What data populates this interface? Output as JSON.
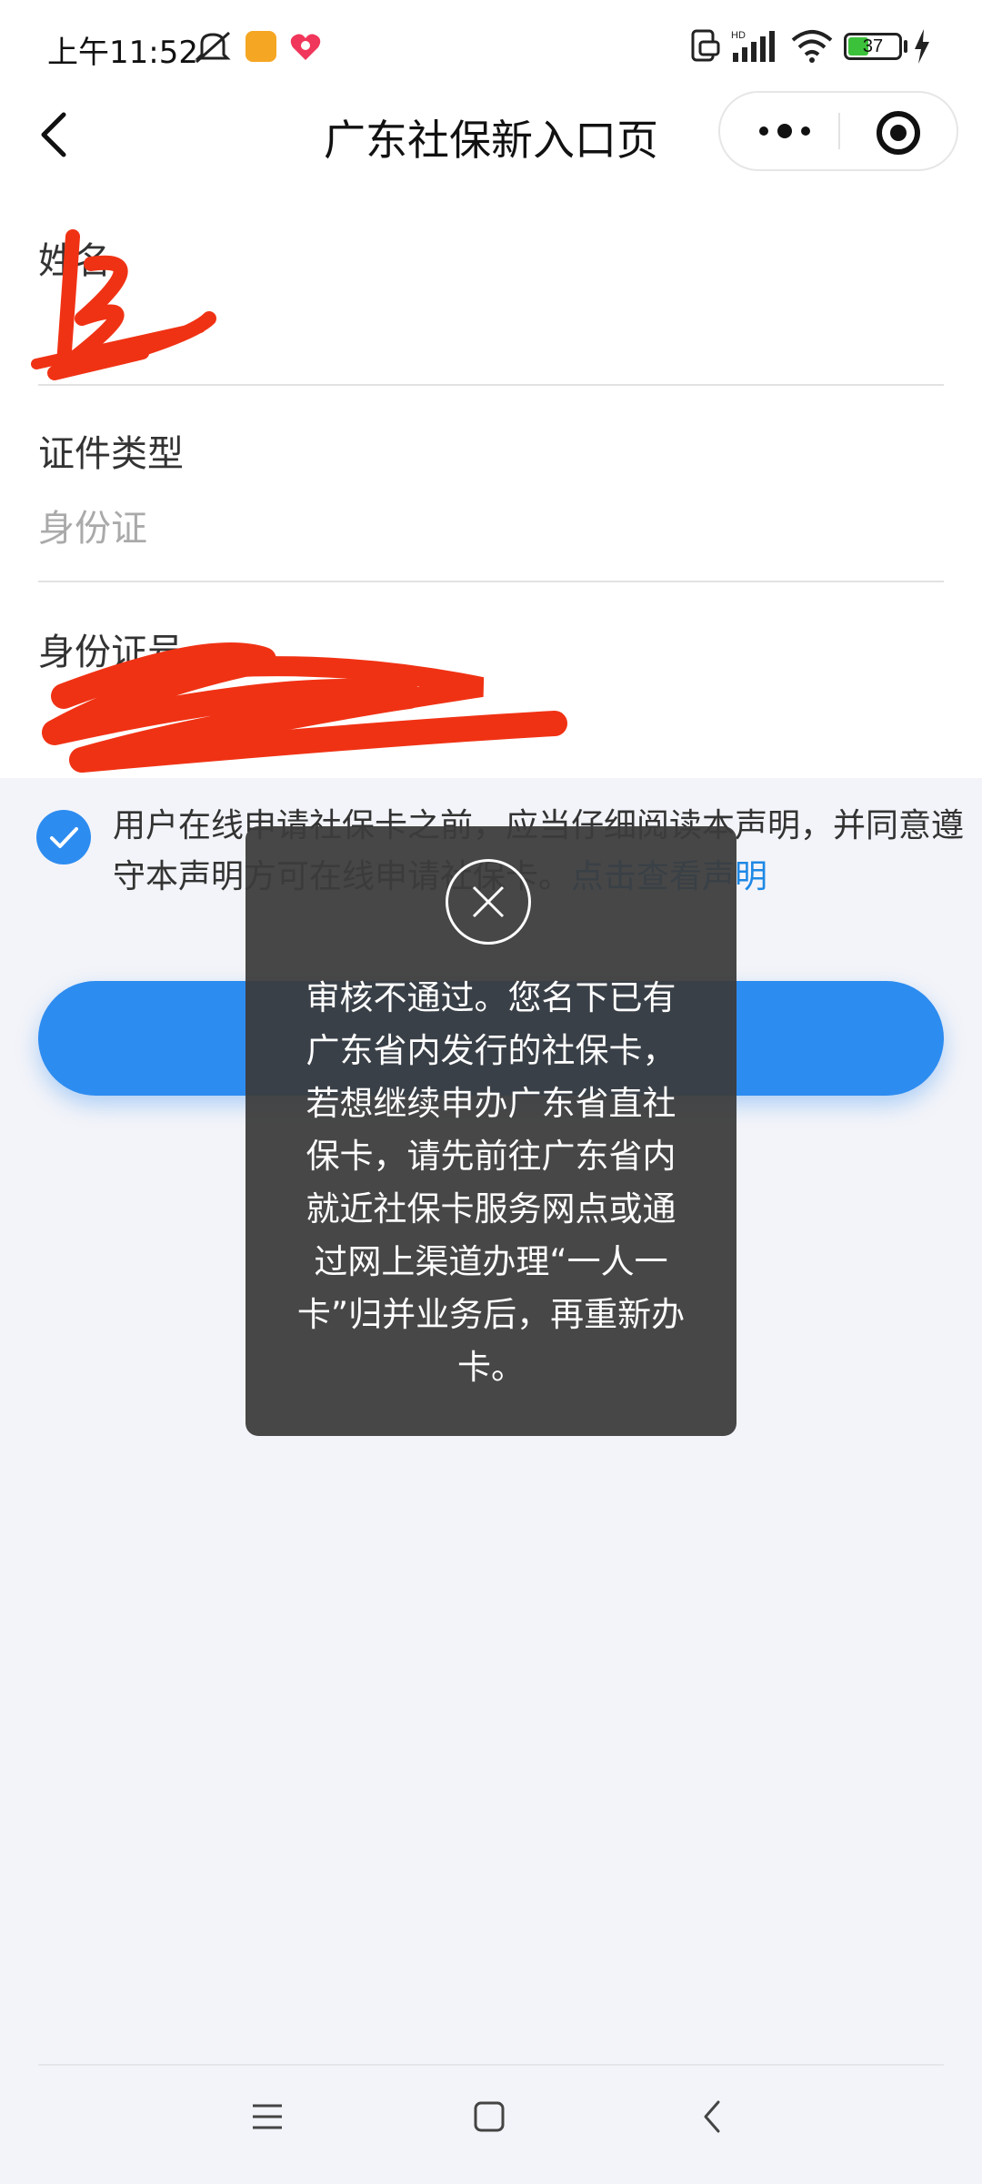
{
  "status_bar": {
    "time": "上午11:52",
    "battery": "37"
  },
  "nav": {
    "title": "广东社保新入口页"
  },
  "form": {
    "name_label": "姓名",
    "id_type_label": "证件类型",
    "id_type_value": "身份证",
    "id_number_label": "身份证号"
  },
  "agreement": {
    "text": "用户在线申请社保卡之前，应当仔细阅读本声明，并同意遵守本声明方可在线申请社保卡。",
    "link": "点击查看声明",
    "checked": true
  },
  "toast": {
    "message": "审核不通过。您名下已有\n广东省内发行的社保卡，\n若想继续申办广东省直社\n保卡，请先前往广东省内\n就近社保卡服务网点或通\n过网上渠道办理“一人一\n卡”归并业务后，再重新办\n卡。"
  },
  "colors": {
    "primary": "#2d8cf0",
    "link": "#1e88e5",
    "toast_bg": "#3c3c3c",
    "redaction": "#f03214"
  }
}
